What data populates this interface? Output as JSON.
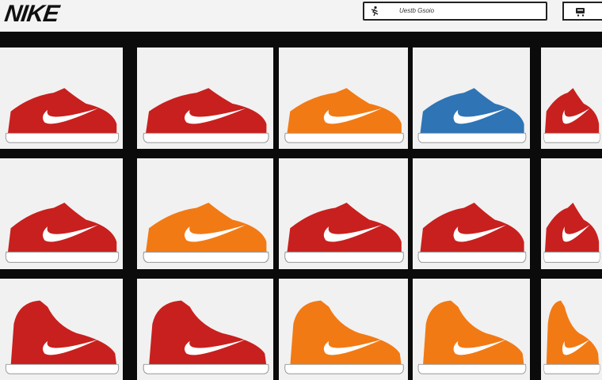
{
  "header": {
    "logo_text": "NIKE",
    "search_text": "Uestb Gsoio",
    "search_icon": "athlete-icon",
    "cart_icon": "cart-icon"
  },
  "grid": {
    "rows": [
      [
        "red",
        "red",
        "orange",
        "blue",
        "red"
      ],
      [
        "red",
        "orange",
        "red",
        "red",
        "red"
      ],
      [
        "red",
        "red",
        "orange",
        "orange",
        "orange"
      ]
    ],
    "colors": {
      "red": "#c8201e",
      "orange": "#f27a14",
      "blue": "#2f74b5",
      "swoosh": "#ffffff",
      "sole": "#ffffff"
    }
  }
}
